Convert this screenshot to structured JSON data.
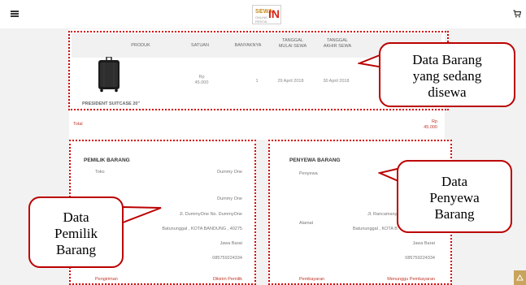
{
  "header": {
    "logo_primary": "SEWA",
    "logo_secondary": "IN",
    "logo_tagline": "ONLINE RENTAL"
  },
  "icons": {
    "menu": "menu-icon",
    "cart": "cart-icon",
    "scroll_top": "scroll-to-top-icon"
  },
  "table": {
    "headers": {
      "produk": "PRODUK",
      "satuan": "SATUAN",
      "banyaknya": "BANYAKNYA",
      "mulai_1": "TANGGAL",
      "mulai_2": "MULAI SEWA",
      "akhir_1": "TANGGAL",
      "akhir_2": "AKHIR SEWA"
    },
    "row": {
      "satuan_1": "Rp",
      "satuan_2": "45.000",
      "qty": "1",
      "start": "29 April 2018",
      "end": "30 April 2018",
      "product_name": "PRESIDENT SUITCASE 20\""
    }
  },
  "total": {
    "label": "Total",
    "currency": "Rp",
    "amount": "45.000"
  },
  "owner": {
    "title": "PEMILIK BARANG",
    "toko_label": "Toko",
    "toko_value": "Dummy One",
    "name": "Dummy One",
    "address": "Jl. DummyOne No. DummyOne",
    "city": "Batununggal , KOTA BANDUNG , 40275",
    "province": "Jawa Barat",
    "phone": "085759224334",
    "pengiriman_label": "Pengiriman",
    "pengiriman_value": "Dikirim Pemilik"
  },
  "renter": {
    "title": "PENYEWA BARANG",
    "penyewa_label": "Penyewa",
    "alamat_label": "Alamat",
    "address": "Jl. Rancamanyar",
    "city": "Batununggal , KOTA B",
    "province": "Jawa Barat",
    "phone": "085759224334",
    "pembayaran_label": "Pembayaran",
    "pembayaran_value": "Menunggu Pembayaran"
  },
  "annotations": {
    "barang": [
      "Data Barang",
      "yang sedang",
      "disewa"
    ],
    "penyewa": [
      "Data",
      "Penyewa",
      "Barang"
    ],
    "pemilik": [
      "Data",
      "Pemilik",
      "Barang"
    ]
  },
  "colors": {
    "accent_red": "#c0392b",
    "annotation_red": "#d10000",
    "logo_gold": "#c38a1a",
    "scroll_button": "#c9a45c"
  }
}
